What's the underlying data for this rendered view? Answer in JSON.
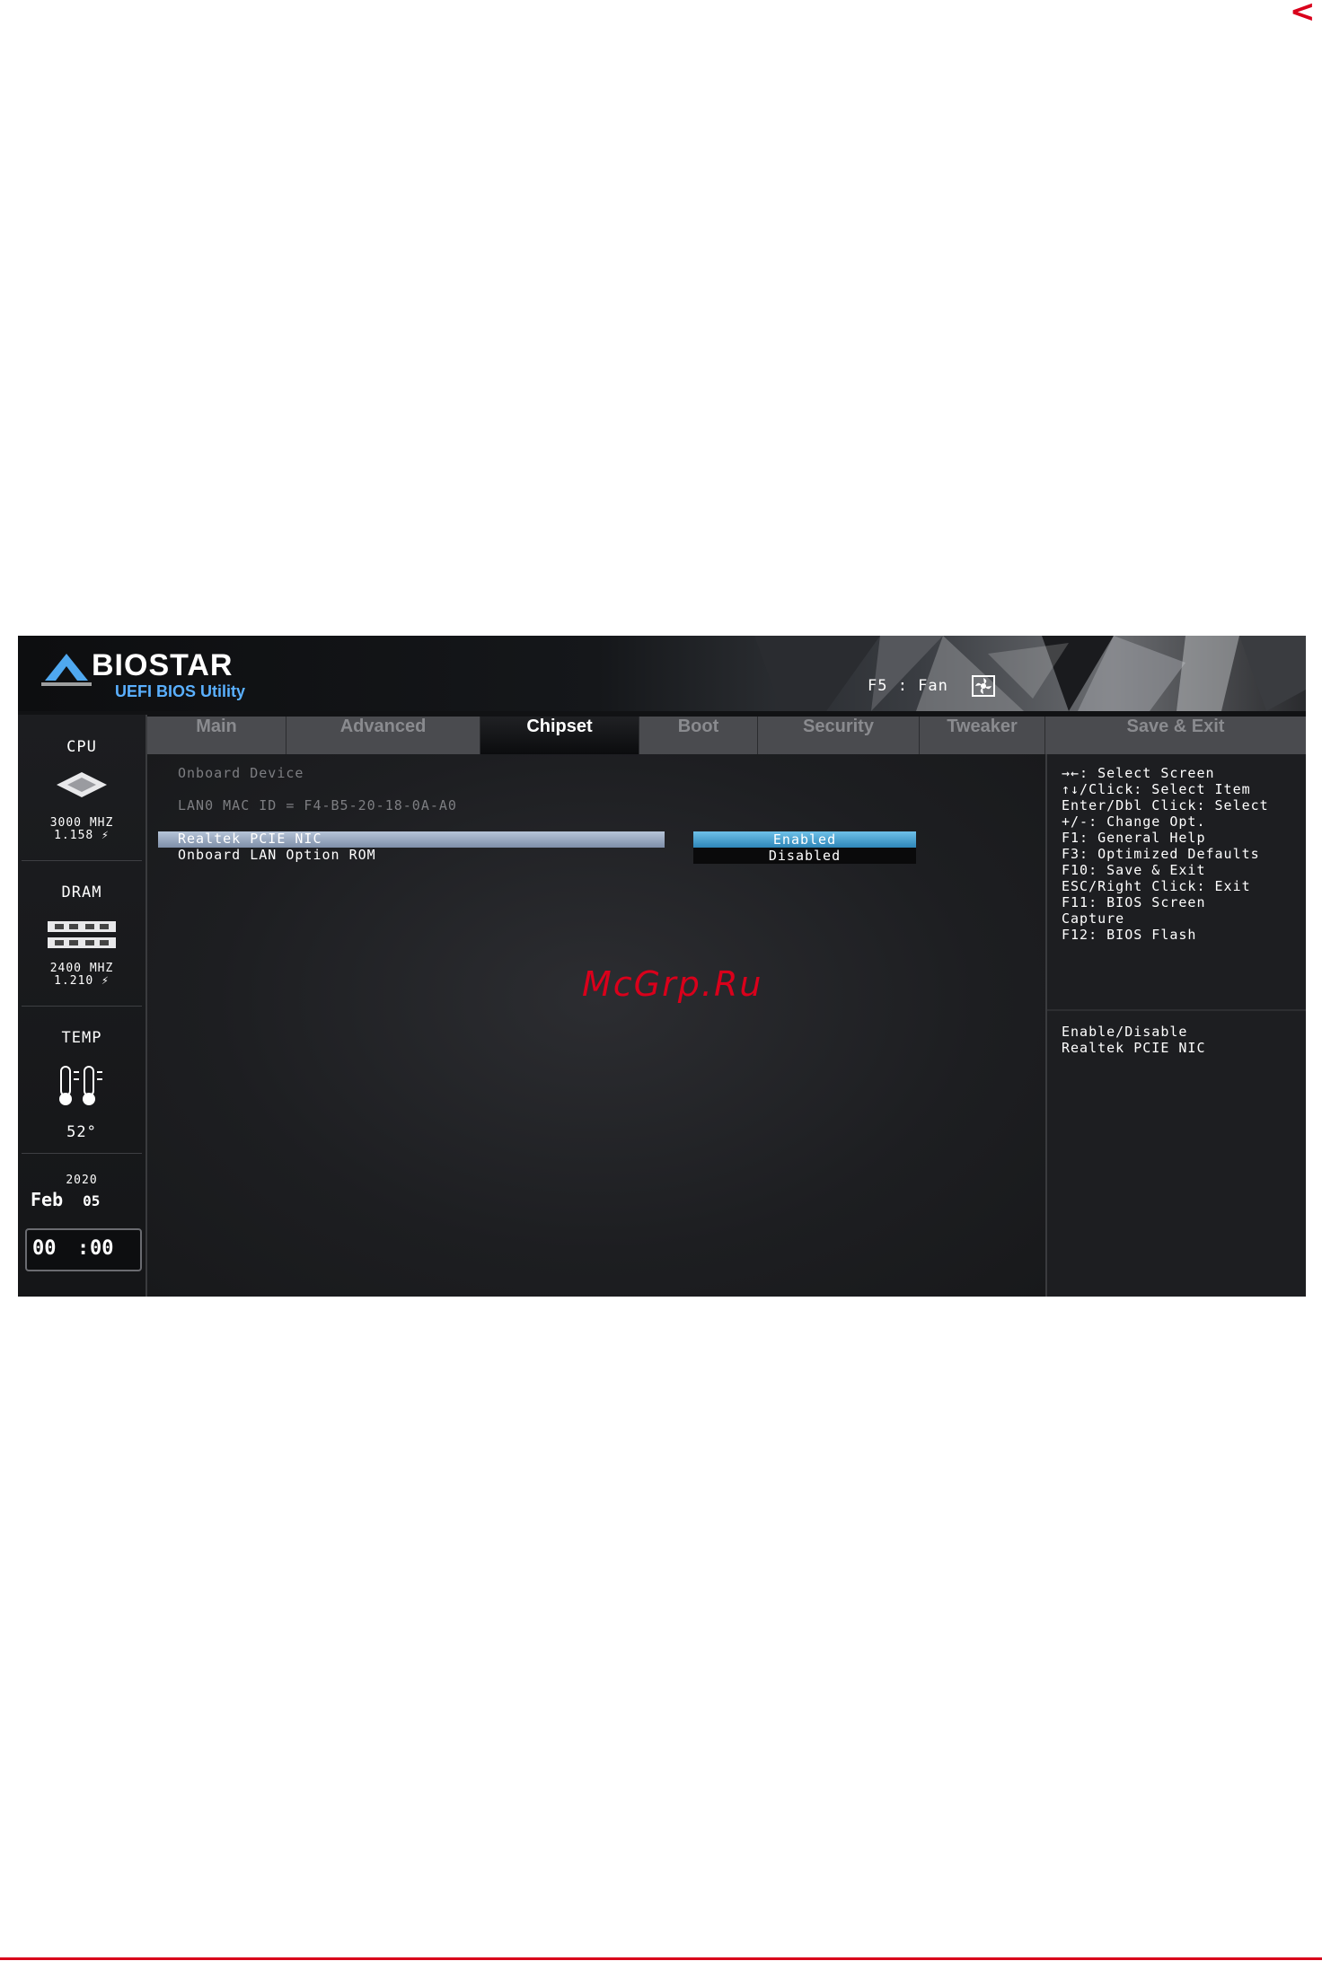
{
  "page": {
    "back_arrow": "<",
    "watermark": "McGrp.Ru"
  },
  "banner": {
    "brand": "BIOSTAR",
    "subtitle": "UEFI BIOS Utility",
    "fan_hint": "F5 : Fan",
    "fan_icon": "fan-icon"
  },
  "sidebar": {
    "cpu": {
      "label": "CPU",
      "freq": "3000 MHZ",
      "volt": "1.158 ⚡",
      "icon": "cpu-chip-icon"
    },
    "dram": {
      "label": "DRAM",
      "freq": "2400 MHZ",
      "volt": "1.210 ⚡",
      "icon": "memory-module-icon"
    },
    "temp": {
      "label": "TEMP",
      "value": "52°",
      "icon": "thermometer-icon"
    },
    "date": {
      "year": "2020",
      "month": "Feb",
      "day": "05"
    },
    "clock": {
      "hh": "00",
      "mm": "00"
    }
  },
  "tabs": [
    {
      "label": "Main"
    },
    {
      "label": "Advanced"
    },
    {
      "label": "Chipset"
    },
    {
      "label": "Boot"
    },
    {
      "label": "Security"
    },
    {
      "label": "Tweaker"
    },
    {
      "label": "Save & Exit"
    }
  ],
  "active_tab": "Chipset",
  "content": {
    "section_title": "Onboard Device",
    "mac_line": "LAN0 MAC ID = F4-B5-20-18-0A-A0",
    "items": [
      {
        "label": "Realtek PCIE NIC",
        "value": "Enabled",
        "selected": true
      },
      {
        "label": "Onboard LAN Option ROM",
        "value": "Disabled",
        "selected": false
      }
    ]
  },
  "help": {
    "keys": [
      "→←: Select Screen",
      "↑↓/Click: Select Item",
      "Enter/Dbl Click: Select",
      "+/-: Change Opt.",
      "F1: General Help",
      "F3: Optimized Defaults",
      "F10: Save & Exit",
      "ESC/Right Click: Exit",
      "F11: BIOS Screen",
      "Capture",
      "F12: BIOS Flash"
    ],
    "description": [
      "Enable/Disable",
      "Realtek PCIE NIC"
    ]
  },
  "colors": {
    "accent_red": "#d9001b",
    "selection_blue": "#2e86b8",
    "logo_blue": "#5ab0ff"
  }
}
